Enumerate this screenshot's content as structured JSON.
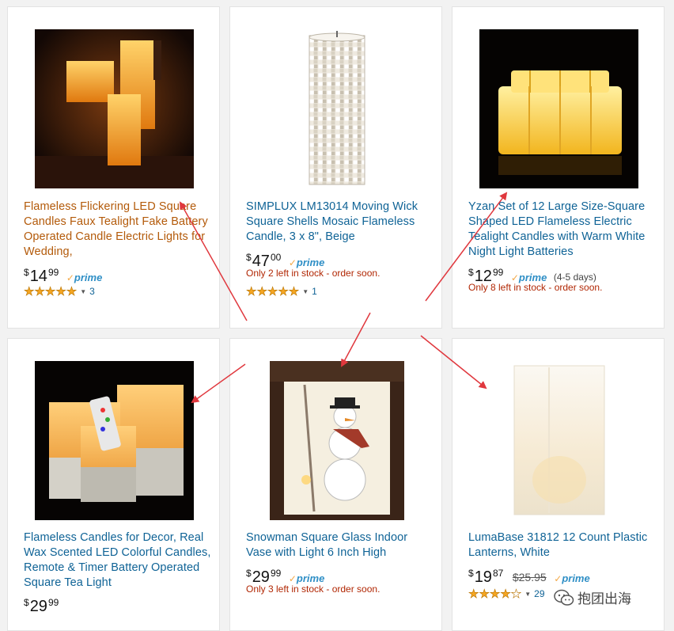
{
  "products": [
    {
      "title": "Flameless Flickering LED Square Candles Faux Tealight Fake Battery Operated Candle Electric Lights for Wedding,",
      "price_currency": "$",
      "price_whole": "14",
      "price_fraction": "99",
      "prime_label": "prime",
      "stars": 5,
      "stars_text": "★★★★★",
      "review_count": "3",
      "image_icon": "square-candles-glowing-image"
    },
    {
      "title": "SIMPLUX LM13014 Moving Wick Square Shells Mosaic Flameless Candle, 3 x 8\", Beige",
      "price_currency": "$",
      "price_whole": "47",
      "price_fraction": "00",
      "prime_label": "prime",
      "stock_text": "Only 2 left in stock - order soon.",
      "stars": 5,
      "stars_text": "★★★★★",
      "review_count": "1",
      "image_icon": "mosaic-pillar-candle-image"
    },
    {
      "title": "Yzan Set of 12 Large Size-Square Shaped LED Flameless Electric Tealight Candles with Warm White Night Light Batteries",
      "price_currency": "$",
      "price_whole": "12",
      "price_fraction": "99",
      "prime_label": "prime",
      "delivery_text": "(4-5 days)",
      "stock_text": "Only 8 left in stock - order soon.",
      "image_icon": "tealight-grid-image"
    },
    {
      "title": "Flameless Candles for Decor, Real Wax Scented LED Colorful Candles, Remote & Timer Battery Operated Square Tea Light",
      "price_currency": "$",
      "price_whole": "29",
      "price_fraction": "99",
      "image_icon": "candles-with-remote-image"
    },
    {
      "title": "Snowman Square Glass Indoor Vase with Light 6 Inch High",
      "price_currency": "$",
      "price_whole": "29",
      "price_fraction": "99",
      "prime_label": "prime",
      "stock_text": "Only 3 left in stock - order soon.",
      "image_icon": "snowman-glass-vase-image"
    },
    {
      "title": "LumaBase 31812 12 Count Plastic Lanterns, White",
      "price_currency": "$",
      "price_whole": "19",
      "price_fraction": "87",
      "list_price": "$25.95",
      "prime_label": "prime",
      "stars": 4,
      "stars_filled_text": "★★★★",
      "stars_empty_text": "★",
      "review_count": "29",
      "image_icon": "white-paper-lantern-image"
    }
  ],
  "ui": {
    "prime_check": "✓",
    "rating_caret": "▼"
  },
  "watermark": {
    "text": "抱团出海",
    "icon": "wechat-icon"
  },
  "colors": {
    "link": "#0f6396",
    "visited_link": "#b35a0a",
    "stock": "#b12704",
    "prime": "#2f8fc6",
    "star": "#f5a623",
    "arrow": "#e0383e"
  }
}
